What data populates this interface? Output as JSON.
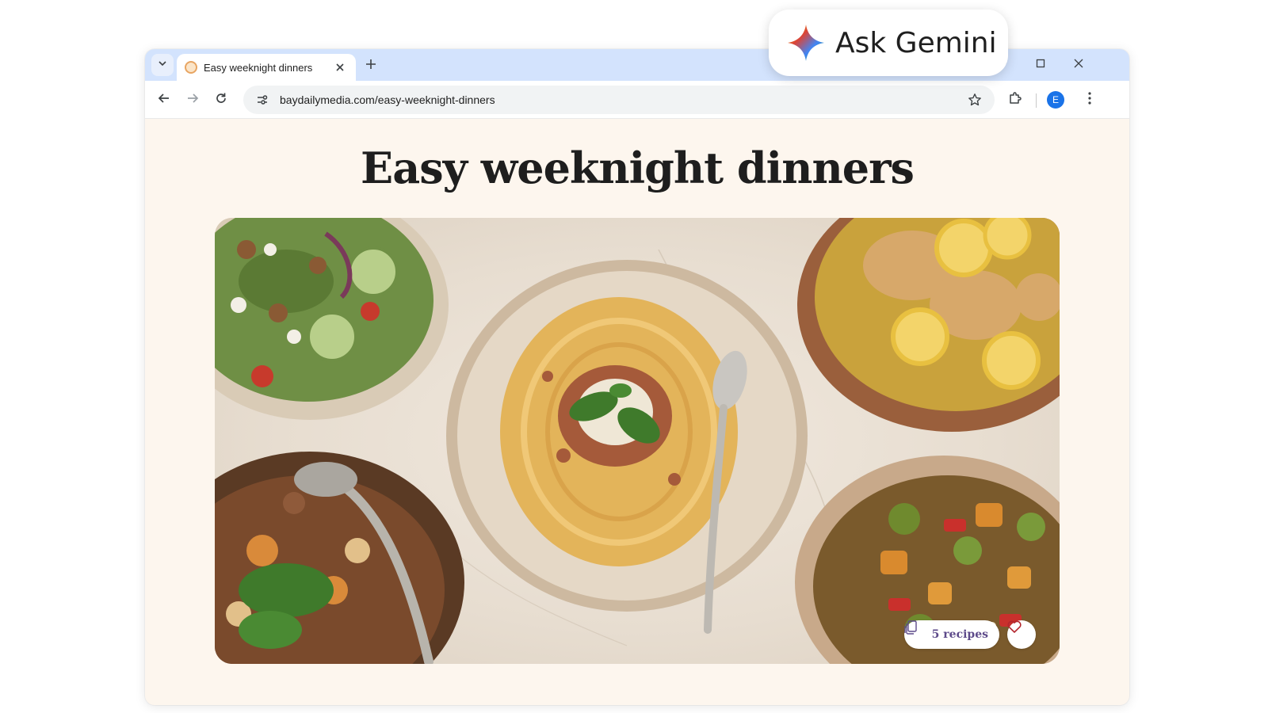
{
  "browser": {
    "tab": {
      "title": "Easy weeknight dinners"
    },
    "url": "baydailymedia.com/easy-weeknight-dinners",
    "profile_initial": "E",
    "icons": [
      "tab-list-icon",
      "favicon-icon",
      "close-icon",
      "plus-icon",
      "minimize-icon",
      "maximize-icon",
      "window-close-icon",
      "back-icon",
      "forward-icon",
      "reload-icon",
      "site-info-icon",
      "star-icon",
      "extensions-icon",
      "more-vert-icon"
    ]
  },
  "page": {
    "title": "Easy weeknight dinners",
    "hero": {
      "recipes_badge": "5 recipes",
      "icons": [
        "recipes-icon",
        "heart-icon"
      ]
    }
  },
  "overlay": {
    "ask_gemini": "Ask Gemini",
    "icon": "gemini-sparkle-icon"
  },
  "colors": {
    "tabstrip": "#d3e3fd",
    "page_background": "#fdf6ee",
    "profile": "#1a73e8",
    "badge_text": "#5d4a8a"
  }
}
